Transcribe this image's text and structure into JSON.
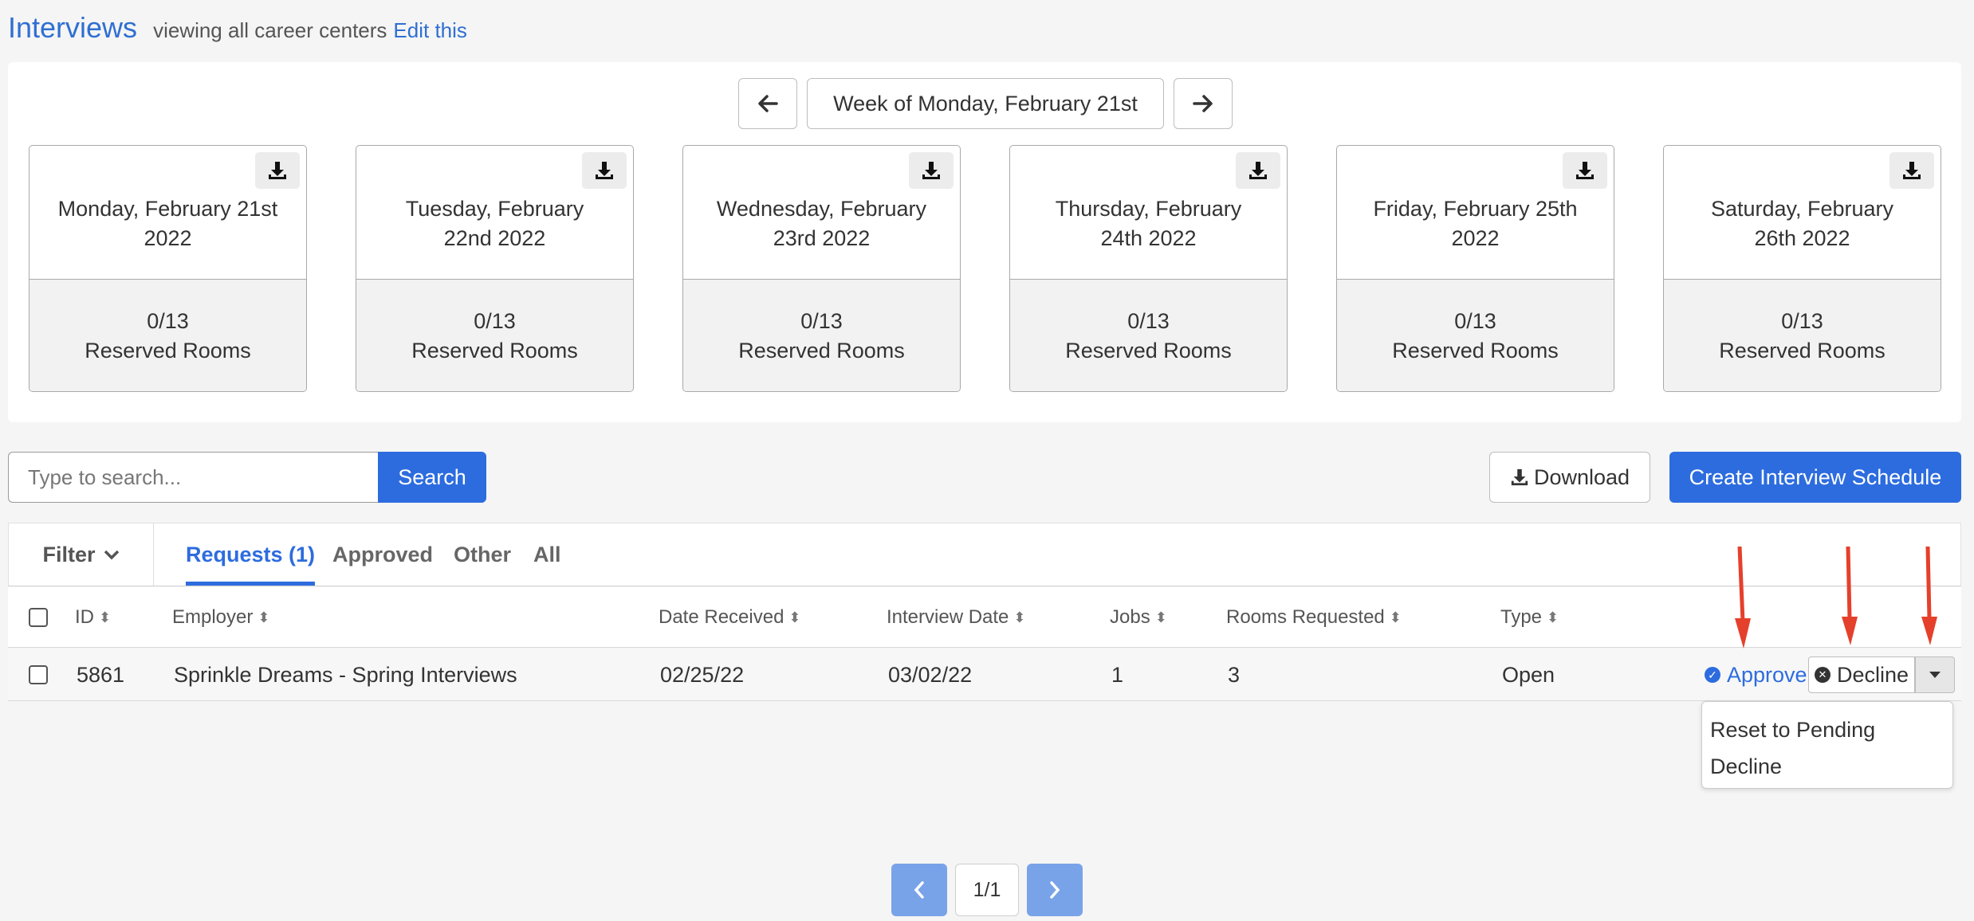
{
  "header": {
    "title": "Interviews",
    "subtitle": "viewing all career centers",
    "edit_link": "Edit this"
  },
  "week_nav": {
    "label": "Week of Monday, February 21st",
    "prev_icon": "arrow-left-icon",
    "next_icon": "arrow-right-icon"
  },
  "days": [
    {
      "date": "Monday, February 21st 2022",
      "reserved": "0/13",
      "reserved_label": "Reserved Rooms"
    },
    {
      "date": "Tuesday, February 22nd 2022",
      "reserved": "0/13",
      "reserved_label": "Reserved Rooms"
    },
    {
      "date": "Wednesday, February 23rd 2022",
      "reserved": "0/13",
      "reserved_label": "Reserved Rooms"
    },
    {
      "date": "Thursday, February 24th 2022",
      "reserved": "0/13",
      "reserved_label": "Reserved Rooms"
    },
    {
      "date": "Friday, February 25th 2022",
      "reserved": "0/13",
      "reserved_label": "Reserved Rooms"
    },
    {
      "date": "Saturday, February 26th 2022",
      "reserved": "0/13",
      "reserved_label": "Reserved Rooms"
    }
  ],
  "search": {
    "placeholder": "Type to search...",
    "button": "Search"
  },
  "actions": {
    "download": "Download",
    "create": "Create Interview Schedule"
  },
  "filter": {
    "label": "Filter"
  },
  "tabs": [
    {
      "label": "Requests (1)",
      "active": true
    },
    {
      "label": "Approved",
      "active": false
    },
    {
      "label": "Other",
      "active": false
    },
    {
      "label": "All",
      "active": false
    }
  ],
  "table": {
    "columns": [
      "ID",
      "Employer",
      "Date Received",
      "Interview Date",
      "Jobs",
      "Rooms Requested",
      "Type"
    ],
    "rows": [
      {
        "id": "5861",
        "employer": "Sprinkle Dreams - Spring Interviews",
        "date_received": "02/25/22",
        "interview_date": "03/02/22",
        "jobs": "1",
        "rooms": "3",
        "type": "Open"
      }
    ],
    "approve": "Approve",
    "decline": "Decline"
  },
  "dropdown": {
    "items": [
      "Reset to Pending",
      "Decline"
    ]
  },
  "pagination": {
    "page": "1/1"
  },
  "colors": {
    "accent": "#2d6cdf",
    "annotation_arrow": "#e5402b"
  }
}
